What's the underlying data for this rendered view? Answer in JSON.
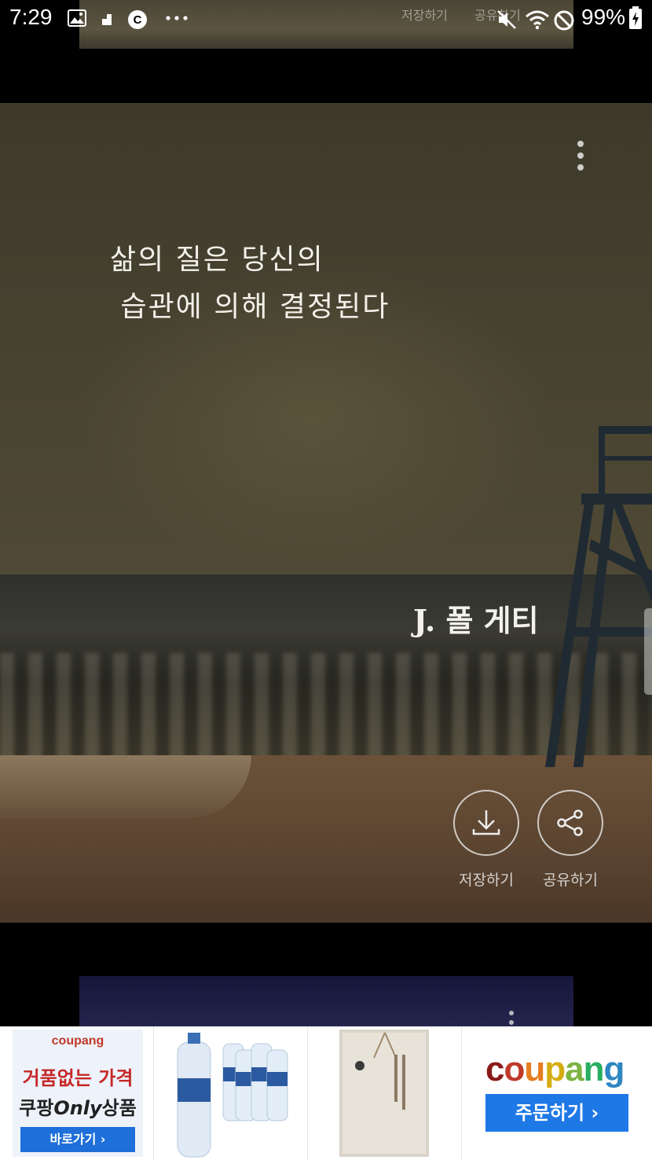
{
  "status_bar": {
    "time": "7:29",
    "battery": "99%",
    "icons": [
      "gallery-icon",
      "sd-card-icon",
      "c-app-icon",
      "more-notifications-icon",
      "mute-icon",
      "wifi-icon",
      "do-not-disturb-icon",
      "battery-charging-icon"
    ]
  },
  "previous_card": {
    "save_label": "저장하기",
    "share_label": "공유하기"
  },
  "quote_card": {
    "quote_line1": "삶의 질은 당신의",
    "quote_line2": " 습관에 의해 결정된다",
    "author": "J. 폴 게티",
    "save_label": "저장하기",
    "share_label": "공유하기"
  },
  "ad": {
    "item1": {
      "brand": "coupang",
      "headline": "거품없는 가격",
      "sub_prefix": "쿠팡",
      "sub_only": "Only",
      "sub_suffix": "상품",
      "cta": "바로가기 ›"
    },
    "item4": {
      "logo_letters": [
        "c",
        "o",
        "u",
        "p",
        "a",
        "n",
        "g"
      ],
      "cta": "주문하기 ›"
    }
  },
  "colors": {
    "coupang_letters": [
      "#8b1a1a",
      "#c0392b",
      "#e67e22",
      "#f1c40f",
      "#7cb342",
      "#27ae60",
      "#2e86c1"
    ],
    "coupang_blue": "#1e78e6"
  }
}
